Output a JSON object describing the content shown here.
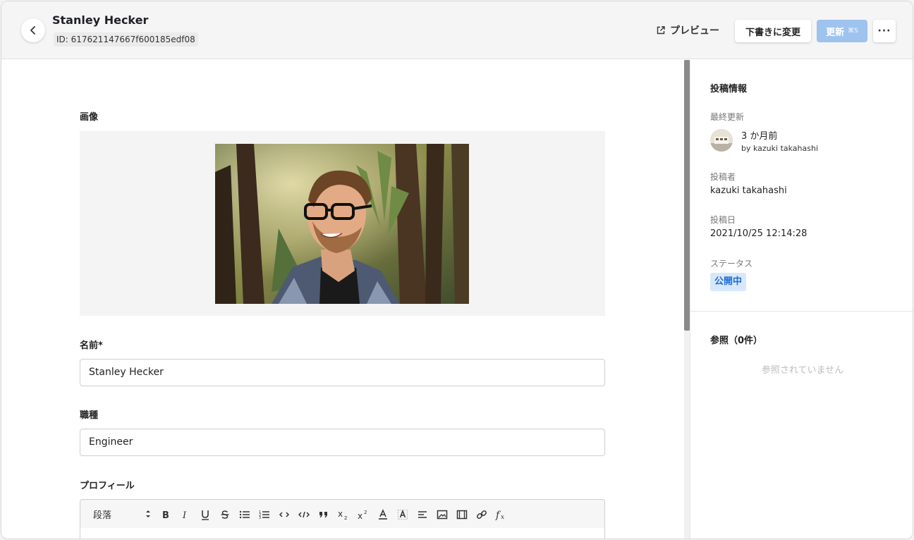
{
  "header": {
    "title": "Stanley Hecker",
    "id_text": "ID: 617621147667f600185edf08",
    "preview_label": "プレビュー",
    "draft_label": "下書きに変更",
    "update_label": "更新",
    "update_shortcut": "⌘S",
    "more_label": "···"
  },
  "main": {
    "image_label": "画像",
    "name_label": "名前*",
    "name_value": "Stanley Hecker",
    "job_label": "職種",
    "job_value": "Engineer",
    "profile_label": "プロフィール",
    "toolbar": {
      "paragraph_label": "段落",
      "buttons": [
        "bold",
        "italic",
        "underline",
        "strikethrough",
        "bullet-list",
        "ordered-list",
        "inline-code",
        "code-block",
        "blockquote",
        "subscript",
        "superscript",
        "text-color",
        "highlight",
        "align",
        "image",
        "embed",
        "link",
        "formula"
      ]
    }
  },
  "side": {
    "post_info_heading": "投稿情報",
    "last_updated_label": "最終更新",
    "last_updated_relative": "3 か月前",
    "last_updated_by": "by kazuki takahashi",
    "author_label": "投稿者",
    "author_value": "kazuki takahashi",
    "posted_date_label": "投稿日",
    "posted_date_value": "2021/10/25 12:14:28",
    "status_label": "ステータス",
    "status_value": "公開中",
    "refs_heading": "参照（0件）",
    "refs_empty": "参照されていません"
  },
  "colors": {
    "update_button": "#9dc3ee",
    "status_badge_bg": "#d7e8fb",
    "status_badge_text": "#1f6bd4"
  }
}
